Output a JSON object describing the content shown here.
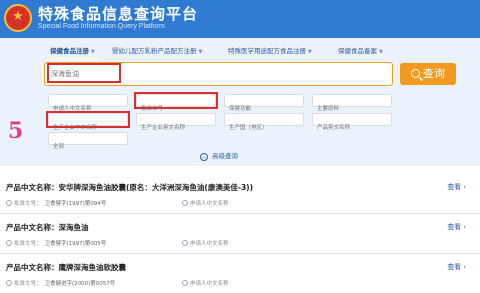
{
  "header": {
    "title": "特殊食品信息查询平台",
    "subtitle": "Special Food Information Query Platform",
    "emblem_icon": "national-emblem-icon"
  },
  "tabs": [
    {
      "label": "保健食品注册",
      "active": true
    },
    {
      "label": "婴幼儿配方乳粉产品配方注册",
      "active": false
    },
    {
      "label": "特殊医学用途配方食品注册",
      "active": false
    },
    {
      "label": "保健食品备案",
      "active": false
    }
  ],
  "search": {
    "placeholder": "深海鱼油",
    "button_label": "查询"
  },
  "filters": {
    "applicant_cn": "申请人中文名称",
    "approval_no": "批准文号",
    "health_function": "保健功能",
    "main_material": "主要原料",
    "manufacturer_cn": "生产企业中文名称",
    "manufacturer_en": "生产企业英文名称",
    "producer_country": "生产国（地区）",
    "product_en": "产品英文名称",
    "all": "全部"
  },
  "annotation": {
    "number": "5"
  },
  "advanced_label": "高级查询",
  "colors": {
    "header": "#2f7bd1",
    "panel": "#eaf2fb",
    "accent": "#f39a1e",
    "mark": "#d83030"
  },
  "results": [
    {
      "title": "产品中文名称：安华牌深海鱼油胶囊(原名：大洋洲深海鱼油(康澳美佳-3))",
      "approval_label": "批准文号：",
      "approval_no": "卫食健字(1997)第094号",
      "applicant_label": "申请人中文名称",
      "view": "查看"
    },
    {
      "title": "产品中文名称：深海鱼油",
      "approval_label": "批准文号：",
      "approval_no": "卫食健字(1997)第005号",
      "applicant_label": "申请人中文名称",
      "view": "查看"
    },
    {
      "title": "产品中文名称：鹰牌深海鱼油软胶囊",
      "approval_label": "批准文号：",
      "approval_no": "卫食健进字(2000)第0057号",
      "applicant_label": "申请人中文名称",
      "view": "查看"
    }
  ]
}
